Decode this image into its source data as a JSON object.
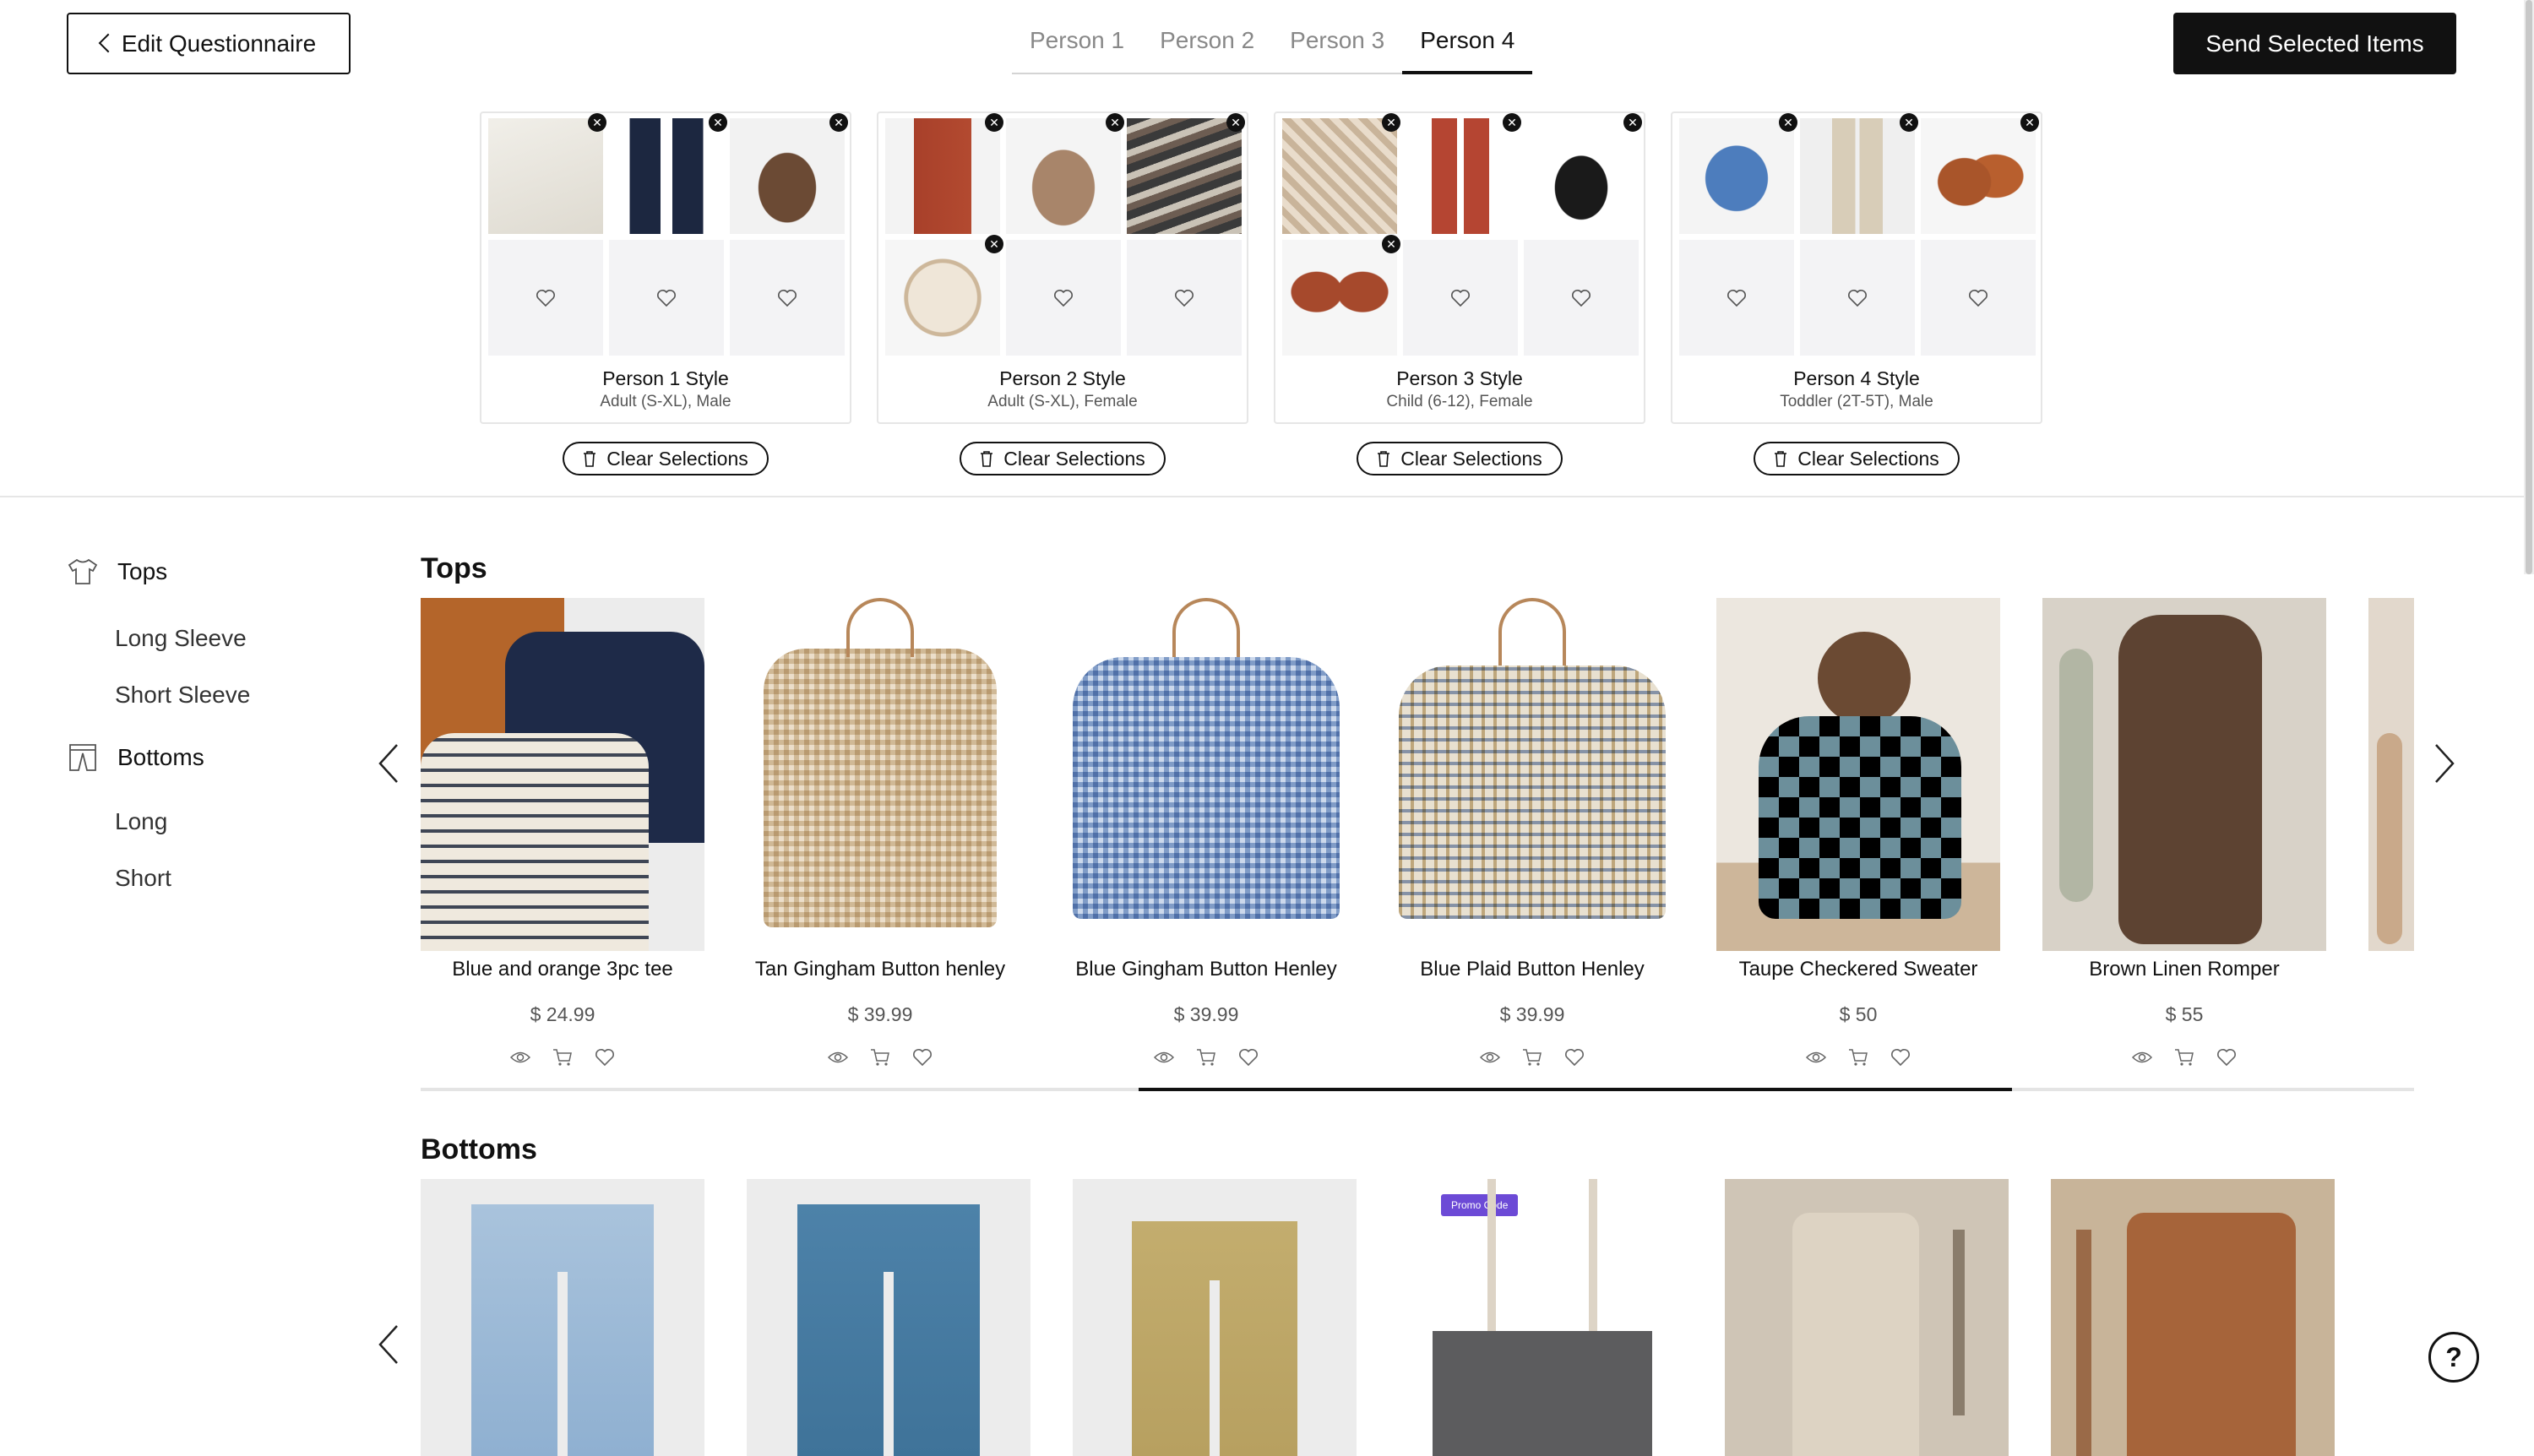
{
  "header": {
    "edit_label": "Edit Questionnaire",
    "tabs": [
      "Person 1",
      "Person 2",
      "Person 3",
      "Person 4"
    ],
    "active_tab": "Person 4",
    "send_label": "Send Selected Items"
  },
  "people": [
    {
      "title": "Person 1 Style",
      "subtitle": "Adult (S-XL), Male",
      "clear_label": "Clear Selections"
    },
    {
      "title": "Person 2 Style",
      "subtitle": "Adult (S-XL), Female",
      "clear_label": "Clear Selections"
    },
    {
      "title": "Person 3 Style",
      "subtitle": "Child (6-12), Female",
      "clear_label": "Clear Selections"
    },
    {
      "title": "Person 4 Style",
      "subtitle": "Toddler (2T-5T), Male",
      "clear_label": "Clear Selections"
    }
  ],
  "sidebar": {
    "tops": {
      "label": "Tops",
      "subs": [
        "Long Sleeve",
        "Short Sleeve"
      ]
    },
    "bottoms": {
      "label": "Bottoms",
      "subs": [
        "Long",
        "Short"
      ]
    }
  },
  "sections": {
    "tops_title": "Tops",
    "bottoms_title": "Bottoms"
  },
  "tops": [
    {
      "name": "Blue and orange 3pc tee",
      "price": "$ 24.99"
    },
    {
      "name": "Tan Gingham Button henley",
      "price": "$ 39.99"
    },
    {
      "name": "Blue Gingham Button Henley",
      "price": "$ 39.99"
    },
    {
      "name": "Blue Plaid Button Henley",
      "price": "$ 39.99"
    },
    {
      "name": "Taupe Checkered Sweater",
      "price": "$ 50"
    },
    {
      "name": "Brown Linen Romper",
      "price": "$ 55"
    }
  ],
  "bottoms": {
    "promo_label": "Promo Code"
  },
  "help_symbol": "?",
  "colors": {
    "accent": "#111111",
    "promo": "#6c4ad6"
  }
}
